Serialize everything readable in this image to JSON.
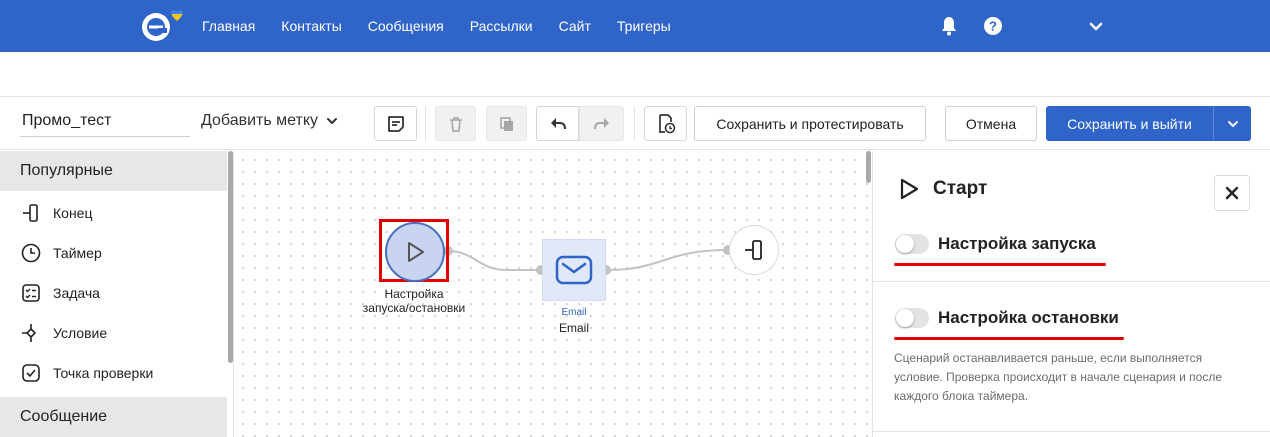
{
  "topnav": {
    "links": [
      "Главная",
      "Контакты",
      "Сообщения",
      "Рассылки",
      "Сайт",
      "Тригеры"
    ],
    "icons": [
      "bell-icon",
      "help-icon",
      "chevron-down-icon"
    ],
    "brand_color": "#2f64c9"
  },
  "toolbar": {
    "scenario_name": "Промо_тест",
    "add_tag_label": "Добавить метку",
    "save_test_label": "Сохранить и протестировать",
    "cancel_label": "Отмена",
    "save_exit_label": "Сохранить и выйти",
    "icons": [
      "notes-icon",
      "trash-icon",
      "copy-icon",
      "undo-icon",
      "redo-icon",
      "history-icon"
    ]
  },
  "sidebar": {
    "section_popular": "Популярные",
    "items": [
      {
        "label": "Конец",
        "icon": "end-icon"
      },
      {
        "label": "Таймер",
        "icon": "timer-icon"
      },
      {
        "label": "Задача",
        "icon": "task-icon"
      },
      {
        "label": "Условие",
        "icon": "condition-icon"
      },
      {
        "label": "Точка проверки",
        "icon": "checkpoint-icon"
      }
    ],
    "section_message": "Сообщение"
  },
  "canvas": {
    "start_node_label_line1": "Настройка",
    "start_node_label_line2": "запуска/остановки",
    "email_node_caption": "Email",
    "email_node_label": "Email"
  },
  "panel": {
    "title": "Старт",
    "launch_toggle_label": "Настройка запуска",
    "stop_toggle_label": "Настройка остановки",
    "launch_enabled": false,
    "stop_enabled": false,
    "stop_description": "Сценарий останавливается раньше, если выполняется условие. Проверка происходит в начале сценария и после каждого блока таймера.",
    "highlight_color": "#e00000"
  }
}
